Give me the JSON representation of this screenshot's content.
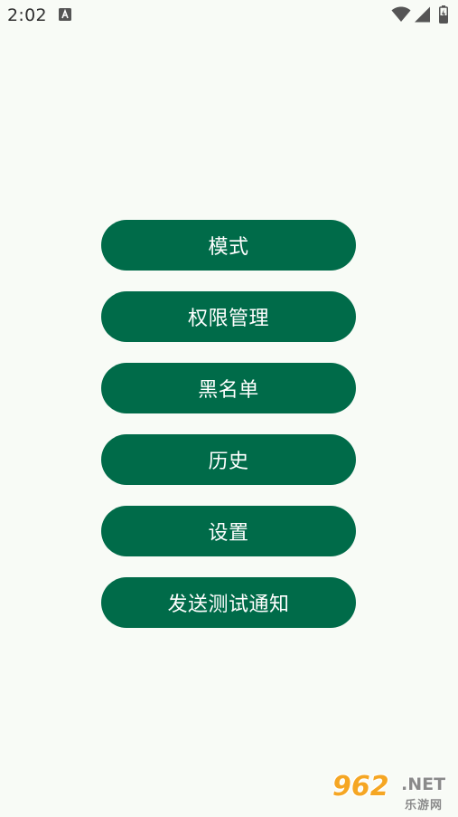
{
  "status_bar": {
    "time": "2:02",
    "icons": [
      "text-notification-icon",
      "wifi-icon",
      "cell-signal-icon",
      "battery-icon"
    ]
  },
  "menu": {
    "items": [
      {
        "label": "模式"
      },
      {
        "label": "权限管理"
      },
      {
        "label": "黑名单"
      },
      {
        "label": "历史"
      },
      {
        "label": "设置"
      },
      {
        "label": "发送测试通知"
      }
    ]
  },
  "watermark": {
    "number": "962",
    "suffix": ".NET",
    "chinese": "乐游网"
  },
  "colors": {
    "background": "#f8fbf6",
    "button": "#006b49",
    "button_text": "#ffffff",
    "watermark_accent": "#f5a623"
  }
}
